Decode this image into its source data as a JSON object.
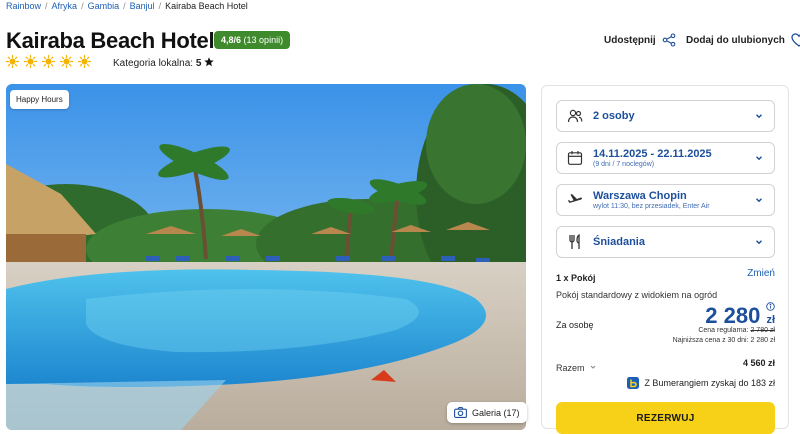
{
  "breadcrumb": [
    "Rainbow",
    "Afryka",
    "Gambia",
    "Banjul"
  ],
  "breadcrumb_current": "Kairaba Beach Hotel",
  "hotel": {
    "name": "Kairaba Beach Hotel",
    "rating_score": "4,8/6",
    "rating_count": "(13 opinii)",
    "sun_count": 5,
    "category_label": "Kategoria lokalna:",
    "category_value": "5"
  },
  "actions": {
    "share": "Udostępnij",
    "favorite": "Dodaj do ulubionych"
  },
  "photo": {
    "badge": "Happy Hours",
    "gallery": "Galeria (17)"
  },
  "booking": {
    "guests": "2 osoby",
    "dates": "14.11.2025 - 22.11.2025",
    "dates_sub": "(9 dni / 7 noclegów)",
    "airport": "Warszawa Chopin",
    "airport_sub": "wylot 11:30, bez przesiadek, Enter Air",
    "board": "Śniadania",
    "room_count": "1 x Pokój",
    "change": "Zmień",
    "room_desc": "Pokój standardowy z widokiem na ogród",
    "per_person_label": "Za osobę",
    "price": "2 280",
    "currency": "zł",
    "regular_label": "Cena regularna:",
    "regular_price": "2 780 zł",
    "lowest_30": "Najniższa cena z 30 dni: 2 280 zł",
    "total_label": "Razem",
    "total_value": "4 560 zł",
    "bumerang": "Z Bumerangiem zyskaj do 183 zł",
    "book_button": "REZERWUJ"
  },
  "colors": {
    "accent_blue": "#1d4f9c",
    "rating_green": "#3f8a2c",
    "book_yellow": "#f7d117",
    "sun": "#f5b400"
  }
}
